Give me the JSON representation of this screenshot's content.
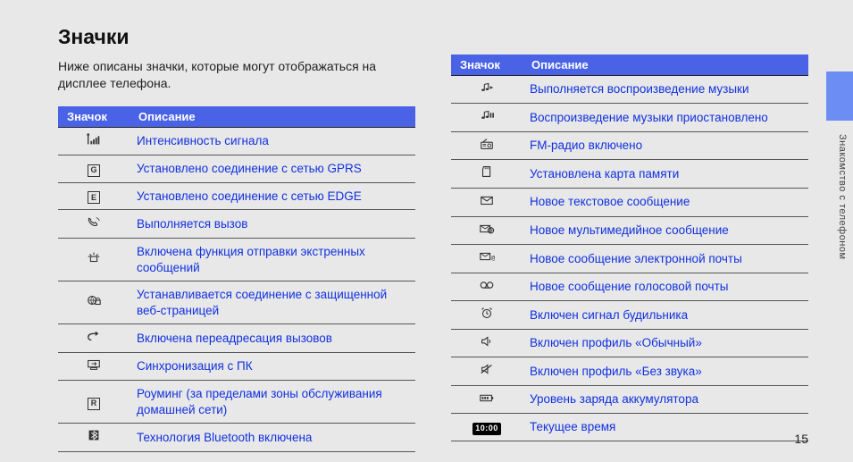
{
  "title": "Значки",
  "intro": "Ниже описаны значки, которые могут отображаться на дисплее телефона.",
  "side_label": "Знакомство с телефоном",
  "page_number": "15",
  "headers": {
    "icon": "Значок",
    "desc": "Описание"
  },
  "left": [
    {
      "icon": "signal",
      "desc": "Интенсивность сигнала"
    },
    {
      "icon": "letter-G",
      "desc": "Установлено соединение с сетью GPRS"
    },
    {
      "icon": "letter-E",
      "desc": "Установлено соединение с сетью EDGE"
    },
    {
      "icon": "call",
      "desc": "Выполняется вызов"
    },
    {
      "icon": "sos",
      "desc": "Включена функция отправки экстренных сообщений"
    },
    {
      "icon": "secure-web",
      "desc": "Устанавливается соединение с защищенной веб-страницей"
    },
    {
      "icon": "forward",
      "desc": "Включена переадресация вызовов"
    },
    {
      "icon": "sync-pc",
      "desc": "Синхронизация с ПК"
    },
    {
      "icon": "letter-R",
      "desc": "Роуминг (за пределами зоны обслуживания домашней сети)"
    },
    {
      "icon": "bluetooth",
      "desc": "Технология Bluetooth включена"
    }
  ],
  "right": [
    {
      "icon": "music-play",
      "desc": "Выполняется воспроизведение музыки"
    },
    {
      "icon": "music-pause",
      "desc": "Воспроизведение музыки приостановлено"
    },
    {
      "icon": "radio",
      "desc": "FM-радио включено"
    },
    {
      "icon": "sdcard",
      "desc": "Установлена карта памяти"
    },
    {
      "icon": "sms",
      "desc": "Новое текстовое сообщение"
    },
    {
      "icon": "mms",
      "desc": "Новое мультимедийное сообщение"
    },
    {
      "icon": "email",
      "desc": "Новое сообщение электронной почты"
    },
    {
      "icon": "voicemail",
      "desc": "Новое сообщение голосовой почты"
    },
    {
      "icon": "alarm",
      "desc": "Включен сигнал будильника"
    },
    {
      "icon": "profile-normal",
      "desc": "Включен профиль «Обычный»"
    },
    {
      "icon": "profile-silent",
      "desc": "Включен профиль «Без звука»"
    },
    {
      "icon": "battery",
      "desc": "Уровень заряда аккумулятора"
    },
    {
      "icon": "time",
      "desc": "Текущее время",
      "icon_text": "10:00"
    }
  ]
}
